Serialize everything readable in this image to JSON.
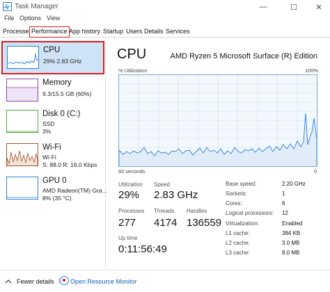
{
  "window": {
    "title": "Task Manager"
  },
  "controls": {
    "minimize": "—",
    "maximize": "☐",
    "close": "✕"
  },
  "menu": {
    "file": "File",
    "options": "Options",
    "view": "View"
  },
  "tabs": [
    "Processes",
    "Performance",
    "App history",
    "Startup",
    "Users",
    "Details",
    "Services"
  ],
  "sidebar": {
    "items": [
      {
        "title": "CPU",
        "sub1": "29%  2.83 GHz",
        "sub2": ""
      },
      {
        "title": "Memory",
        "sub1": "9.3/15.5 GB (60%)",
        "sub2": ""
      },
      {
        "title": "Disk 0 (C:)",
        "sub1": "SSD",
        "sub2": "3%"
      },
      {
        "title": "Wi-Fi",
        "sub1": "Wi-Fi",
        "sub2": "S: 88.0  R: 16.0 Kbps"
      },
      {
        "title": "GPU 0",
        "sub1": "AMD Radeon(TM) Gra...",
        "sub2": "8%  (35 °C)"
      }
    ]
  },
  "main": {
    "title": "CPU",
    "model": "AMD Ryzen 5 Microsoft Surface (R) Edition",
    "graph_top_left": "% Utilization",
    "graph_top_right": "100%",
    "graph_bottom_left": "60 seconds",
    "graph_bottom_right": "0"
  },
  "stats": {
    "utilization": {
      "label": "Utilization",
      "value": "29%"
    },
    "speed": {
      "label": "Speed",
      "value": "2.83 GHz"
    },
    "processes": {
      "label": "Processes",
      "value": "277"
    },
    "threads": {
      "label": "Threads",
      "value": "4174"
    },
    "handles": {
      "label": "Handles",
      "value": "136559"
    },
    "uptime": {
      "label": "Up time",
      "value": "0:11:56:49"
    }
  },
  "details": [
    {
      "label": "Base speed:",
      "value": "2.20 GHz"
    },
    {
      "label": "Sockets:",
      "value": "1"
    },
    {
      "label": "Cores:",
      "value": "6"
    },
    {
      "label": "Logical processors:",
      "value": "12"
    },
    {
      "label": "Virtualization:",
      "value": "Enabled"
    },
    {
      "label": "L1 cache:",
      "value": "384 KB"
    },
    {
      "label": "L2 cache:",
      "value": "3.0 MB"
    },
    {
      "label": "L3 cache:",
      "value": "8.0 MB"
    }
  ],
  "footer": {
    "fewer_details": "Fewer details",
    "separator": "|",
    "resource_monitor": "Open Resource Monitor"
  },
  "colors": {
    "accent": "#2b7fd4",
    "highlight": "#e0191f",
    "selected_bg": "#cfe3f6",
    "memory": "#8e44ad",
    "disk": "#4aa832",
    "wifi": "#a0522d",
    "gpu": "#2b7fd4"
  }
}
